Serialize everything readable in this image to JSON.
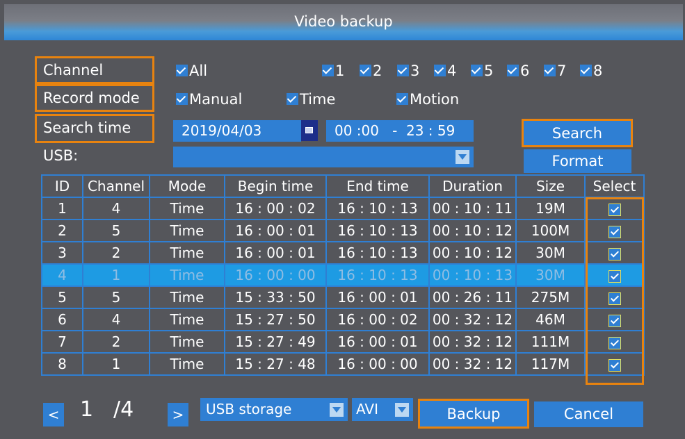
{
  "window": {
    "title": "Video backup"
  },
  "labels": {
    "channel": "Channel",
    "record_mode": "Record mode",
    "search_time": "Search time",
    "usb": "USB:"
  },
  "channels": {
    "all_label": "All",
    "all_checked": true,
    "items": [
      "1",
      "2",
      "3",
      "4",
      "5",
      "6",
      "7",
      "8"
    ]
  },
  "record_modes": [
    "Manual",
    "Time",
    "Motion"
  ],
  "search": {
    "date": "2019/04/03",
    "time_range": "00 :00   -  23 : 59",
    "search_label": "Search",
    "format_label": "Format"
  },
  "usb": {
    "value": ""
  },
  "table": {
    "headers": [
      "ID",
      "Channel",
      "Mode",
      "Begin time",
      "End time",
      "Duration",
      "Size",
      "Select"
    ],
    "highlighted_row": 3,
    "rows": [
      [
        "1",
        "4",
        "Time",
        "16 : 00 : 02",
        "16 : 10 : 13",
        "00 : 10 : 11",
        "19M"
      ],
      [
        "2",
        "5",
        "Time",
        "16 : 00 : 01",
        "16 : 10 : 13",
        "00 : 10 : 12",
        "100M"
      ],
      [
        "3",
        "2",
        "Time",
        "16 : 00 : 01",
        "16 : 10 : 13",
        "00 : 10 : 12",
        "30M"
      ],
      [
        "4",
        "1",
        "Time",
        "16 : 00 : 00",
        "16 : 10 : 13",
        "00 : 10 : 13",
        "30M"
      ],
      [
        "5",
        "5",
        "Time",
        "15 : 33 : 50",
        "16 : 00 : 01",
        "00 : 26 : 11",
        "275M"
      ],
      [
        "6",
        "4",
        "Time",
        "15 : 27 : 50",
        "16 : 00 : 02",
        "00 : 32 : 12",
        "46M"
      ],
      [
        "7",
        "2",
        "Time",
        "15 : 27 : 49",
        "16 : 00 : 01",
        "00 : 32 : 12",
        "111M"
      ],
      [
        "8",
        "1",
        "Time",
        "15 : 27 : 48",
        "16 : 00 : 00",
        "00 : 32 : 12",
        "117M"
      ]
    ]
  },
  "footer": {
    "prev_icon": "chevron-left-icon",
    "next_icon": "chevron-right-icon",
    "prev_glyph": "<",
    "next_glyph": ">",
    "current_page": "1",
    "total_pages": "/4",
    "storage": "USB storage",
    "file_format": "AVI",
    "backup_label": "Backup",
    "cancel_label": "Cancel"
  },
  "colors": {
    "background": "#55565b",
    "accent_blue": "#2f7fd3",
    "highlight_row": "#1e9be3",
    "focus_orange": "#e8830f"
  }
}
